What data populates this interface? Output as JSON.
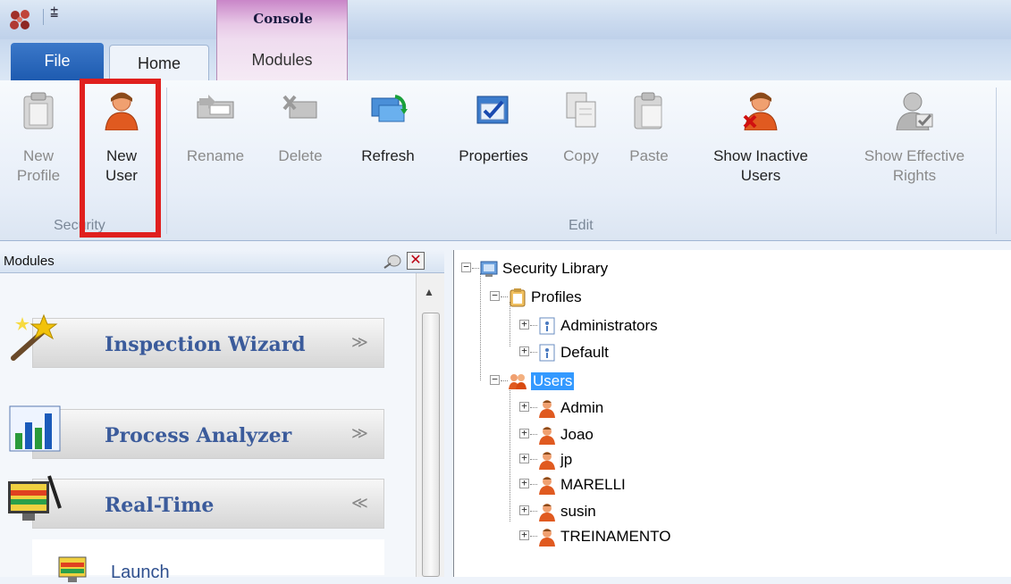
{
  "window": {
    "context_tab_title": "Console"
  },
  "tabs": {
    "file": "File",
    "home": "Home",
    "modules": "Modules"
  },
  "ribbon": {
    "buttons": [
      {
        "label1": "New",
        "label2": "Profile",
        "icon": "clipboard-icon",
        "enabled": false
      },
      {
        "label1": "New",
        "label2": "User",
        "icon": "user-icon",
        "enabled": true
      },
      {
        "label1": "Rename",
        "label2": "",
        "icon": "rename-icon",
        "enabled": false
      },
      {
        "label1": "Delete",
        "label2": "",
        "icon": "delete-icon",
        "enabled": false
      },
      {
        "label1": "Refresh",
        "label2": "",
        "icon": "refresh-icon",
        "enabled": true
      },
      {
        "label1": "Properties",
        "label2": "",
        "icon": "properties-icon",
        "enabled": true
      },
      {
        "label1": "Copy",
        "label2": "",
        "icon": "copy-icon",
        "enabled": false
      },
      {
        "label1": "Paste",
        "label2": "",
        "icon": "paste-icon",
        "enabled": false
      },
      {
        "label1": "Show Inactive",
        "label2": "Users",
        "icon": "inactive-user-icon",
        "enabled": true
      },
      {
        "label1": "Show Effective",
        "label2": "Rights",
        "icon": "effective-rights-icon",
        "enabled": false
      }
    ],
    "groups": {
      "security": "Security",
      "edit": "Edit"
    },
    "highlight_color": "#e0201e"
  },
  "modules_panel": {
    "title": "Modules",
    "items": [
      {
        "label": "Inspection Wizard",
        "chevron": "≫",
        "icon": "wizard-wand-icon"
      },
      {
        "label": "Process Analyzer",
        "chevron": "≫",
        "icon": "bar-chart-icon"
      },
      {
        "label": "Real-Time",
        "chevron": "≪",
        "icon": "monitor-icon"
      }
    ],
    "launch_label": "Launch"
  },
  "tree": {
    "root": "Security Library",
    "profiles_label": "Profiles",
    "profiles": [
      "Administrators",
      "Default"
    ],
    "users_label": "Users",
    "users": [
      "Admin",
      "Joao",
      "jp",
      "MARELLI",
      "susin",
      "TREINAMENTO"
    ],
    "selection_color": "#3399ff"
  }
}
